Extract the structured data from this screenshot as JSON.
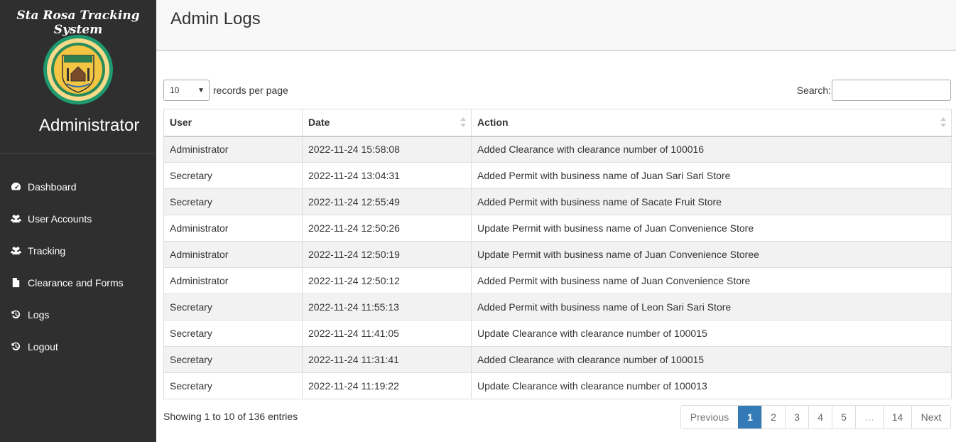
{
  "sidebar": {
    "brand": "Sta Rosa Tracking System",
    "role": "Administrator",
    "items": [
      {
        "label": "Dashboard",
        "icon": "dashboard-icon"
      },
      {
        "label": "User Accounts",
        "icon": "users-icon"
      },
      {
        "label": "Tracking",
        "icon": "users-icon"
      },
      {
        "label": "Clearance and Forms",
        "icon": "file-icon"
      },
      {
        "label": "Logs",
        "icon": "history-icon"
      },
      {
        "label": "Logout",
        "icon": "history-icon"
      }
    ]
  },
  "header": {
    "title": "Admin Logs"
  },
  "controls": {
    "length_value": "10",
    "length_label": "records per page",
    "search_label": "Search:",
    "search_value": ""
  },
  "table": {
    "columns": [
      "User",
      "Date",
      "Action"
    ],
    "rows": [
      [
        "Administrator",
        "2022-11-24 15:58:08",
        "Added Clearance with clearance number of 100016"
      ],
      [
        "Secretary",
        "2022-11-24 13:04:31",
        "Added Permit with business name of Juan Sari Sari Store"
      ],
      [
        "Secretary",
        "2022-11-24 12:55:49",
        "Added Permit with business name of Sacate Fruit Store"
      ],
      [
        "Administrator",
        "2022-11-24 12:50:26",
        "Update Permit with business name of Juan Convenience Store"
      ],
      [
        "Administrator",
        "2022-11-24 12:50:19",
        "Update Permit with business name of Juan Convenience Storee"
      ],
      [
        "Administrator",
        "2022-11-24 12:50:12",
        "Added Permit with business name of Juan Convenience Store"
      ],
      [
        "Secretary",
        "2022-11-24 11:55:13",
        "Added Permit with business name of Leon Sari Sari Store"
      ],
      [
        "Secretary",
        "2022-11-24 11:41:05",
        "Update Clearance with clearance number of 100015"
      ],
      [
        "Secretary",
        "2022-11-24 11:31:41",
        "Added Clearance with clearance number of 100015"
      ],
      [
        "Secretary",
        "2022-11-24 11:19:22",
        "Update Clearance with clearance number of 100013"
      ]
    ]
  },
  "footer": {
    "info": "Showing 1 to 10 of 136 entries",
    "pagination": {
      "previous": "Previous",
      "pages": [
        "1",
        "2",
        "3",
        "4",
        "5",
        "…",
        "14"
      ],
      "next": "Next",
      "active": "1"
    }
  },
  "colors": {
    "sidebar_bg": "#2f2f2f",
    "accent": "#337ab7",
    "seal_ring": "#1e9a6e",
    "seal_shield": "#f4c542"
  }
}
